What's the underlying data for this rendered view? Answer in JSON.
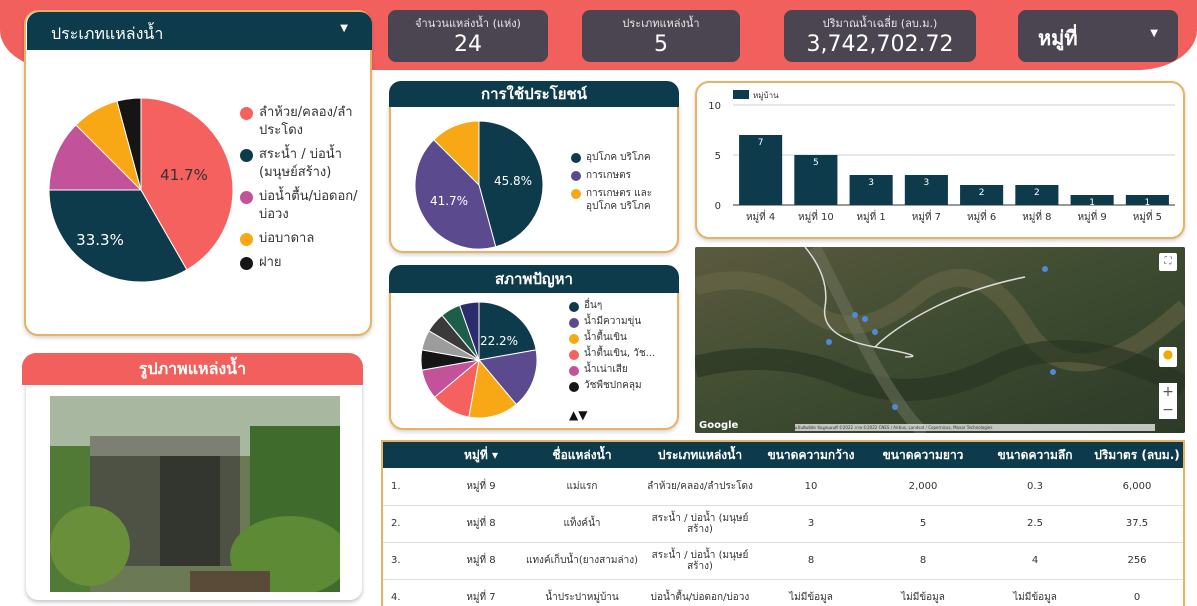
{
  "filters": {
    "type_dropdown": "ประเภทแหล่งน้ำ",
    "village_dropdown": "หมู่ที่"
  },
  "stats": [
    {
      "label": "จำนวนแหล่งน้ำ (แห่ง)",
      "value": "24"
    },
    {
      "label": "ประเภทแหล่งน้ำ",
      "value": "5"
    },
    {
      "label": "ปริมาณน้ำเฉลี่ย (ลบ.ม.)",
      "value": "3,742,702.72"
    }
  ],
  "type_pie": {
    "labels": [
      "41.7%",
      "33.3%"
    ],
    "legend": [
      "ลำห้วย/คลอง/ลำประโดง",
      "สระน้ำ / บ่อน้ำ (มนุษย์สร้าง)",
      "บ่อน้ำตื้น/บ่อดอก/บ่อวง",
      "บ่อบาดาล",
      "ฝาย"
    ],
    "colors": [
      "#f4615e",
      "#0d3b4b",
      "#c2539a",
      "#f7a814",
      "#151515"
    ],
    "values": [
      41.7,
      33.3,
      12.5,
      8.3,
      4.2
    ]
  },
  "usage": {
    "title": "การใช้ประโยชน์",
    "labels": [
      "45.8%",
      "41.7%"
    ],
    "legend": [
      "อุปโภค บริโภค",
      "การเกษตร",
      "การเกษตร และ อุปโภค บริโภค"
    ],
    "colors": [
      "#0d3b4b",
      "#5b4a8e",
      "#f7a814"
    ],
    "values": [
      45.8,
      41.7,
      12.5
    ]
  },
  "problems": {
    "title": "สภาพปัญหา",
    "label": "22.2%",
    "legend": [
      "อื่นๆ",
      "น้ำมีความขุ่น",
      "น้ำตื้นเขิน",
      "น้ำตื้นเขิน, วัช...",
      "น้ำเน่าเสีย",
      "วัชพืชปกคลุม"
    ],
    "legend_colors": [
      "#0d3b4b",
      "#5b4a8e",
      "#f7a814",
      "#f4615e",
      "#c2539a",
      "#151515"
    ],
    "pager": "▲▼"
  },
  "chart_data": {
    "type": "bar",
    "categories": [
      "หมู่ที่ 4",
      "หมู่ที่ 10",
      "หมู่ที่ 1",
      "หมู่ที่ 7",
      "หมู่ที่ 6",
      "หมู่ที่ 8",
      "หมู่ที่ 9",
      "หมู่ที่ 5"
    ],
    "values": [
      7,
      5,
      3,
      3,
      2,
      2,
      1,
      1
    ],
    "series": [
      {
        "name": "หมู่บ้าน",
        "values": [
          7,
          5,
          3,
          3,
          2,
          2,
          1,
          1
        ]
      }
    ],
    "yticks": [
      "10",
      "5",
      "0"
    ],
    "ylim": [
      0,
      10
    ],
    "grid": true,
    "legend": "top-left",
    "color": "#0d3b4b"
  },
  "photo": {
    "title": "รูปภาพแหล่งน้ำ"
  },
  "map": {
    "google_label": "Google",
    "attribution": "แป้นพิมพ์ลัด ข้อมูลแผนที่ ©2022 ภาพ ©2022 CNES / Airbus, Landsat / Copernicus, Maxar Technologies"
  },
  "table": {
    "headers": [
      "",
      "หมู่ที่ ▾",
      "ชื่อแหล่งน้ำ",
      "ประเภทแหล่งน้ำ",
      "ขนาดความกว้าง",
      "ขนาดความยาว",
      "ขนาดความลึก",
      "ปริมาตร (ลบม.)"
    ],
    "rows": [
      [
        "1.",
        "หมู่ที่ 9",
        "แม่แรก",
        "ลำห้วย/คลอง/ลำประโดง",
        "10",
        "2,000",
        "0.3",
        "6,000"
      ],
      [
        "2.",
        "หมู่ที่ 8",
        "แท็งค์น้ำ",
        "สระน้ำ / บ่อน้ำ (มนุษย์สร้าง)",
        "3",
        "5",
        "2.5",
        "37.5"
      ],
      [
        "3.",
        "หมู่ที่ 8",
        "แทงค์เก็บน้ำ(ยางสามล่าง)",
        "สระน้ำ / บ่อน้ำ (มนุษย์สร้าง)",
        "8",
        "8",
        "4",
        "256"
      ],
      [
        "4.",
        "หมู่ที่ 7",
        "น้ำประปาหมู่บ้าน",
        "บ่อน้ำตื้น/บ่อดอก/บ่อวง",
        "ไม่มีข้อมูล",
        "ไม่มีข้อมูล",
        "ไม่มีข้อมูล",
        "0"
      ]
    ]
  }
}
